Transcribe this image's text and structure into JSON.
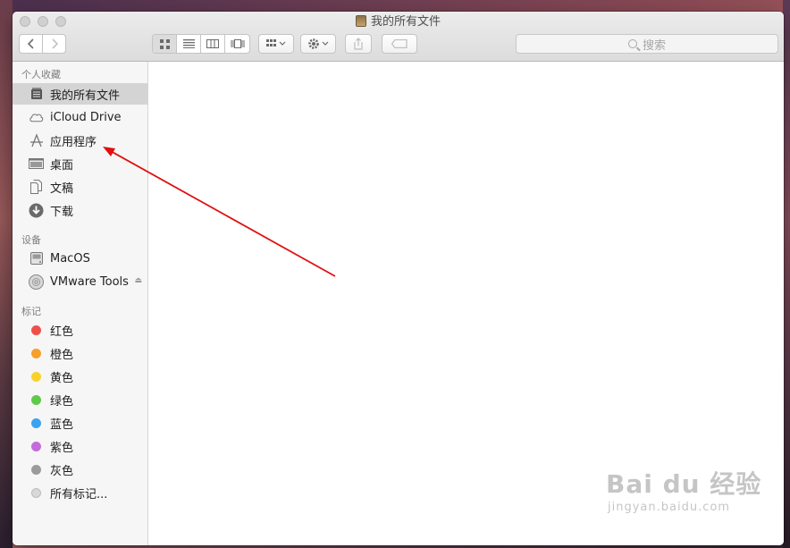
{
  "window": {
    "title": "我的所有文件"
  },
  "toolbar": {
    "search_placeholder": "搜索",
    "back_icon": "chevron-left",
    "forward_icon": "chevron-right"
  },
  "sidebar": {
    "favorites_title": "个人收藏",
    "favorites": [
      {
        "label": "我的所有文件",
        "icon": "all-files-icon",
        "selected": true
      },
      {
        "label": "iCloud Drive",
        "icon": "cloud-icon"
      },
      {
        "label": "应用程序",
        "icon": "applications-icon"
      },
      {
        "label": "桌面",
        "icon": "desktop-icon"
      },
      {
        "label": "文稿",
        "icon": "documents-icon"
      },
      {
        "label": "下载",
        "icon": "download-icon"
      }
    ],
    "devices_title": "设备",
    "devices": [
      {
        "label": "MacOS",
        "icon": "hard-drive-icon"
      },
      {
        "label": "VMware Tools",
        "icon": "disc-icon",
        "eject": true
      }
    ],
    "tags_title": "标记",
    "tags": [
      {
        "label": "红色",
        "color": "#f0504c"
      },
      {
        "label": "橙色",
        "color": "#f5a02c"
      },
      {
        "label": "黄色",
        "color": "#f8d22c"
      },
      {
        "label": "绿色",
        "color": "#5ec94a"
      },
      {
        "label": "蓝色",
        "color": "#3aa3f0"
      },
      {
        "label": "紫色",
        "color": "#c36bdb"
      },
      {
        "label": "灰色",
        "color": "#9b9b9b"
      },
      {
        "label": "所有标记...",
        "color": "#d8d8d8"
      }
    ]
  },
  "annotation": {
    "color": "#e01010"
  },
  "watermark": {
    "main": "Bai du 经验",
    "sub": "jingyan.baidu.com"
  }
}
